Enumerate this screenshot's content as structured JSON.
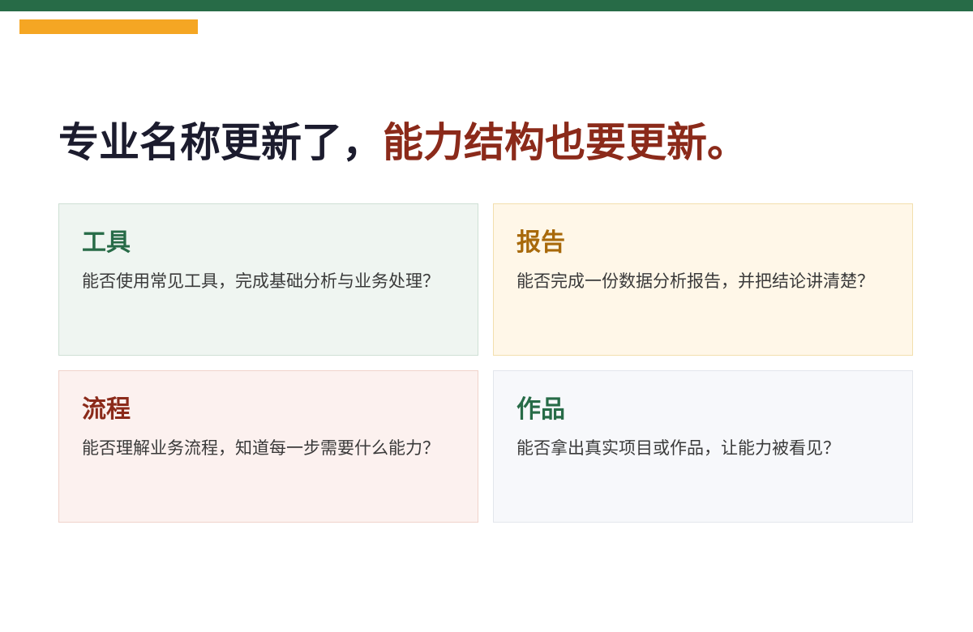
{
  "colors": {
    "top_bar": "#276b47",
    "accent_bar": "#f5a623",
    "headline_dark": "#1c1c2e",
    "headline_red": "#8b2a1a"
  },
  "headline": {
    "part1": "专业名称更新了，",
    "part2": "能力结构也要更新。"
  },
  "cards": [
    {
      "title": "工具",
      "description": "能否使用常见工具，完成基础分析与业务处理？",
      "title_color": "#276b47",
      "bg_color": "#eff5f1",
      "border_color": "#cfe0d5"
    },
    {
      "title": "报告",
      "description": "能否完成一份数据分析报告，并把结论讲清楚？",
      "title_color": "#a8690a",
      "bg_color": "#fff7e8",
      "border_color": "#f3dfae"
    },
    {
      "title": "流程",
      "description": "能否理解业务流程，知道每一步需要什么能力？",
      "title_color": "#8b2a1a",
      "bg_color": "#fcf1ef",
      "border_color": "#f0d3cb"
    },
    {
      "title": "作品",
      "description": "能否拿出真实项目或作品，让能力被看见？",
      "title_color": "#276b47",
      "bg_color": "#f7f8fb",
      "border_color": "#e3e6ec"
    }
  ]
}
